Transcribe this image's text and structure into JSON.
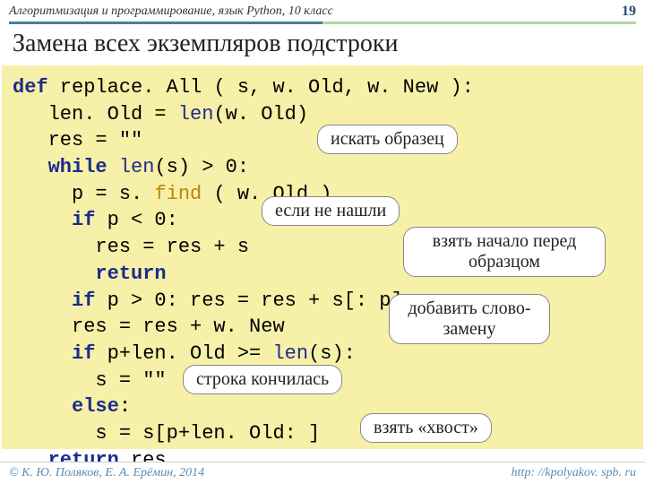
{
  "header": {
    "left": "Алгоритмизация и программирование, язык Python, 10 класс",
    "page": "19"
  },
  "title": "Замена всех экземпляров подстроки",
  "code": {
    "l1_def": "def",
    "l1_name": " replace. All ( s, w. Old, w. New ):",
    "l2a": "   len. Old = ",
    "l2_len": "len",
    "l2b": "(w. Old)",
    "l3": "   res = \"\"",
    "l4_while": "   while",
    "l4_len": " len",
    "l4b": "(s) > 0:",
    "l5a": "     p = s. ",
    "l5_find": "find",
    "l5b": " ( w. Old )",
    "l6_if": "     if",
    "l6b": " p < 0:",
    "l7": "       res = res + s",
    "l8_ret": "       return",
    "l9_if": "     if",
    "l9b": " p > 0: res = res + s[: p]",
    "l10": "     res = res + w. New",
    "l11_if": "     if",
    "l11b": " p+len. Old >= ",
    "l11_len": "len",
    "l11c": "(s):",
    "l12": "       s = \"\"",
    "l13_else": "     else",
    "l13b": ":",
    "l14": "       s = s[p+len. Old: ]",
    "l15_ret": "   return",
    "l15b": " res"
  },
  "callouts": {
    "c1": "искать образец",
    "c2": "если не нашли",
    "c3": "взять начало перед образцом",
    "c4": "добавить слово-замену",
    "c5": "строка кончилась",
    "c6": "взять «хвост»"
  },
  "footer": {
    "left": "© К. Ю. Поляков, Е. А. Ерёмин, 2014",
    "right": "http: //kpolyakov. spb. ru"
  }
}
